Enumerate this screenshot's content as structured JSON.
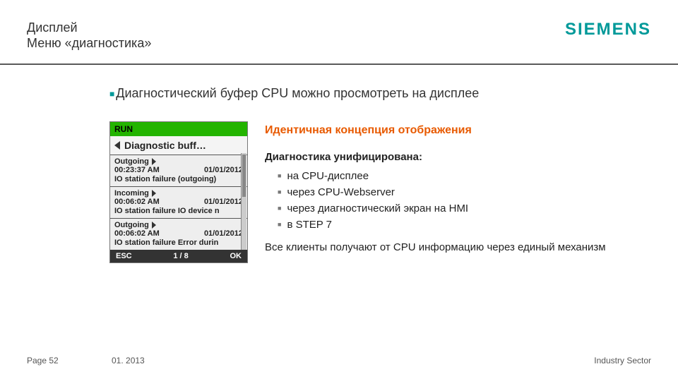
{
  "header": {
    "title_line1": "Дисплей",
    "title_line2": "Меню «диагностика»",
    "brand": "SIEMENS"
  },
  "lead_bullet": "Диагностический буфер CPU можно просмотреть на дисплее",
  "cpu": {
    "run_label": "RUN",
    "screen_title": "Diagnostic buff…",
    "entries": [
      {
        "direction": "Outgoing",
        "time": "00:23:37 AM",
        "date": "01/01/2012",
        "desc": "IO station failure (outgoing)"
      },
      {
        "direction": "Incoming",
        "time": "00:06:02 AM",
        "date": "01/01/2012",
        "desc": "IO station failure IO device n"
      },
      {
        "direction": "Outgoing",
        "time": "00:06:02 AM",
        "date": "01/01/2012",
        "desc": "IO station failure Error durin"
      }
    ],
    "footer_left": "ESC",
    "footer_center": "1 / 8",
    "footer_right": "OK"
  },
  "right": {
    "heading": "Идентичная концепция отображения",
    "intro": "Диагностика унифицирована:",
    "bullets": [
      "на CPU-дисплее",
      "через  CPU-Webserver",
      "через диагностический экран на HMI",
      "в STEP 7"
    ],
    "para": "Все клиенты получают от CPU информацию через единый механизм"
  },
  "footer": {
    "left": "Page 52",
    "center": "01. 2013",
    "right": "Industry Sector"
  }
}
